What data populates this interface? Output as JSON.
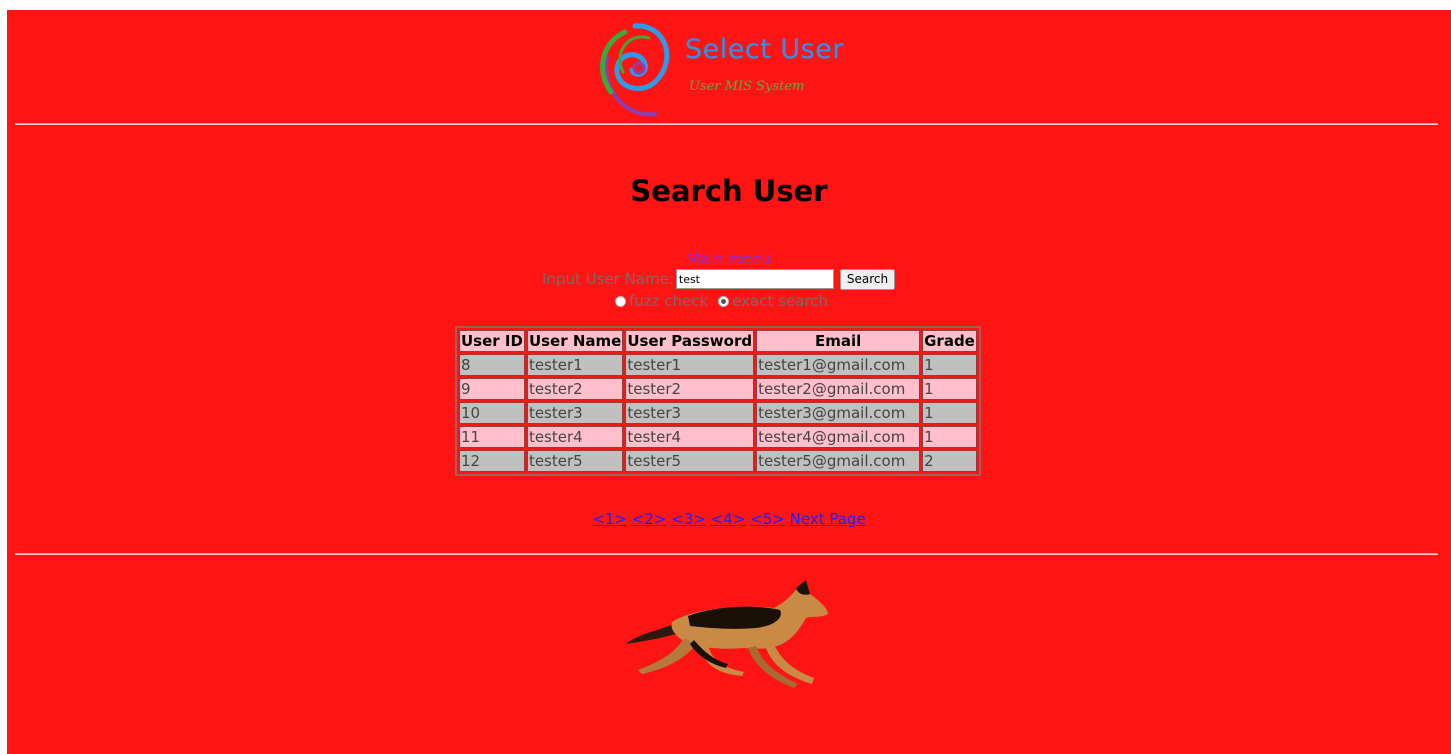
{
  "header": {
    "logo_title": "Select User",
    "logo_subtitle": "User MIS System"
  },
  "page_title": "Search User",
  "main_menu_label": "Main menu",
  "search": {
    "label": "Input User Name:",
    "value": "test",
    "button_label": "Search",
    "options": [
      {
        "label": "fuzz check",
        "checked": false
      },
      {
        "label": "exact search",
        "checked": true
      }
    ]
  },
  "table": {
    "columns": [
      "User ID",
      "User Name",
      "User Password",
      "Email",
      "Grade"
    ],
    "rows": [
      [
        "8",
        "tester1",
        "tester1",
        "tester1@gmail.com",
        "1"
      ],
      [
        "9",
        "tester2",
        "tester2",
        "tester2@gmail.com",
        "1"
      ],
      [
        "10",
        "tester3",
        "tester3",
        "tester3@gmail.com",
        "1"
      ],
      [
        "11",
        "tester4",
        "tester4",
        "tester4@gmail.com",
        "1"
      ],
      [
        "12",
        "tester5",
        "tester5",
        "tester5@gmail.com",
        "2"
      ]
    ]
  },
  "pagination": {
    "pages": [
      "<1>",
      "<2>",
      "<3>",
      "<4>",
      "<5>"
    ],
    "next_label": "Next Page"
  },
  "colors": {
    "background": "#ff1414",
    "row_alt_1": "#c0c0c0",
    "row_alt_2": "#ffc0cb",
    "link": "#2020ff",
    "visited_link": "#8a2be2"
  },
  "icons": {
    "logo": "swirl-logo-icon",
    "footer_image": "german-shepherd-dog-icon"
  }
}
